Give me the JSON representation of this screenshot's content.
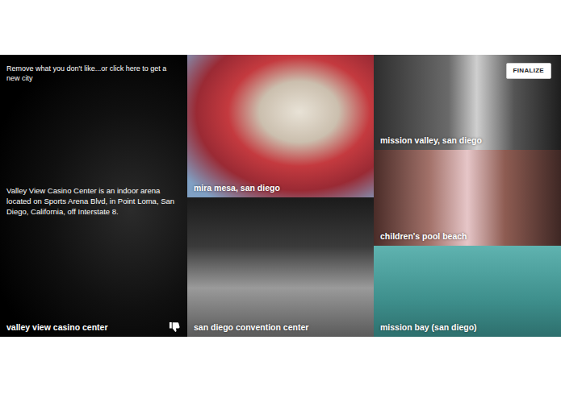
{
  "instruction": "Remove what you don't like...or click here to get a new city",
  "finalize": "FINALIZE",
  "tiles": [
    {
      "label": "valley view casino center",
      "hovered": true,
      "description": "Valley View Casino Center is an indoor arena located on Sports Arena Blvd, in Point Loma, San Diego, California, off Interstate 8."
    },
    {
      "label": "mira mesa, san diego",
      "hovered": false
    },
    {
      "label": "san diego convention center",
      "hovered": false
    },
    {
      "label": "mission valley, san diego",
      "hovered": false
    },
    {
      "label": "children's pool beach",
      "hovered": false
    },
    {
      "label": "mission bay (san diego)",
      "hovered": false
    }
  ]
}
